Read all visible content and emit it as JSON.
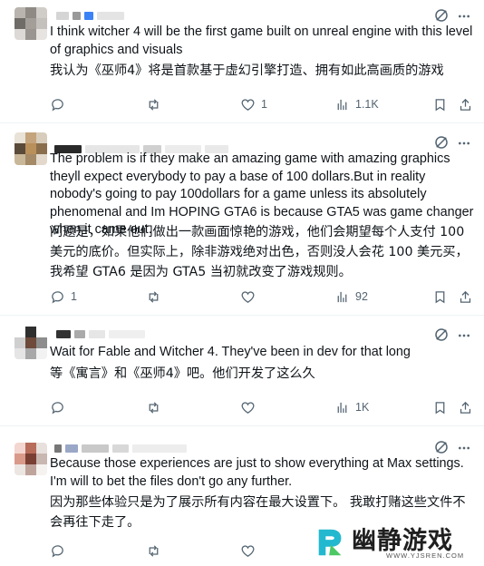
{
  "colors": {
    "icon": "#536471",
    "text": "#0f1419",
    "divider": "#eff3f4",
    "watermark_accent": "#22b8cf"
  },
  "tweets": [
    {
      "text_en": "I think witcher 4 will be the first game built on unreal engine with this level of graphics and visuals",
      "text_zh": "我认为《巫师4》将是首款基于虚幻引擎打造、拥有如此高画质的游戏",
      "replies": "",
      "reposts": "",
      "likes": "1",
      "views": "1.1K"
    },
    {
      "text_en": "The problem is if they make an amazing game with amazing graphics theyll expect everybody to pay a base of 100 dollars.But in reality nobody's going to pay 100dollars for a game unless its absolutely phenomenal and Im HOPING GTA6 is because GTA5 was game changer when it came out.",
      "text_zh": "问题是，如果他们做出一款画面惊艳的游戏，他们会期望每个人支付 100 美元的底价。但实际上，除非游戏绝对出色，否则没人会花 100 美元买，我希望 GTA6 是因为 GTA5 当初就改变了游戏规则。",
      "replies": "1",
      "reposts": "",
      "likes": "",
      "views": "92"
    },
    {
      "text_en": "Wait for Fable and Witcher 4. They've been in dev for that long",
      "text_zh": "等《寓言》和《巫师4》吧。他们开发了这么久",
      "replies": "",
      "reposts": "",
      "likes": "",
      "views": "1K"
    },
    {
      "text_en": "Because those experiences are just to show everything at Max settings. I'm will to bet the files don't go any further.",
      "text_zh": "因为那些体验只是为了展示所有内容在最大设置下。 我敢打赌这些文件不会再往下走了。",
      "replies": "",
      "reposts": "",
      "likes": "",
      "views": ""
    }
  ],
  "watermark": {
    "title": "幽静游戏",
    "url": "WWW.YJSREN.COM"
  }
}
